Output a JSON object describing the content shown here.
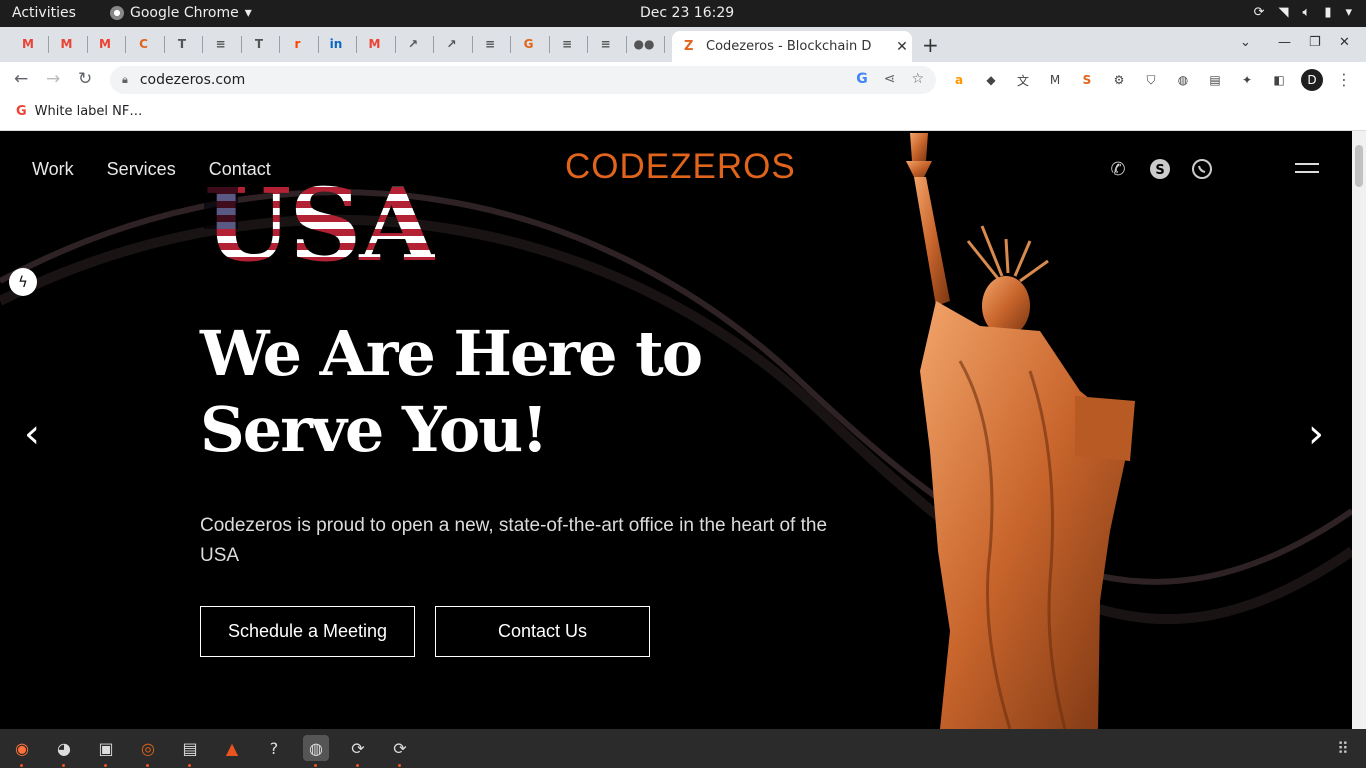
{
  "system": {
    "activities": "Activities",
    "app_name": "Google Chrome",
    "clock": "Dec 23  16:29"
  },
  "browser": {
    "active_tab_title": "Codezeros - Blockchain D",
    "address": "codezeros.com",
    "bookmark": "White label NF…",
    "profile_initial": "D",
    "pinned_tabs": [
      "M",
      "M",
      "M",
      "C",
      "T",
      "≡",
      "T",
      "r",
      "in",
      "M",
      "↗",
      "↗",
      "≡",
      "G",
      "≡",
      "≡",
      "●●"
    ]
  },
  "site": {
    "nav": {
      "work": "Work",
      "services": "Services",
      "contact": "Contact"
    },
    "logo": "CODEZEROS",
    "country": "USA",
    "headline_1": "We Are Here to",
    "headline_2": "Serve You!",
    "subtext": "Codezeros is proud to open a new, state-of-the-art office in the heart of the USA",
    "cta_meeting": "Schedule a Meeting",
    "cta_contact": "Contact Us",
    "accent_color": "#e0641b"
  }
}
